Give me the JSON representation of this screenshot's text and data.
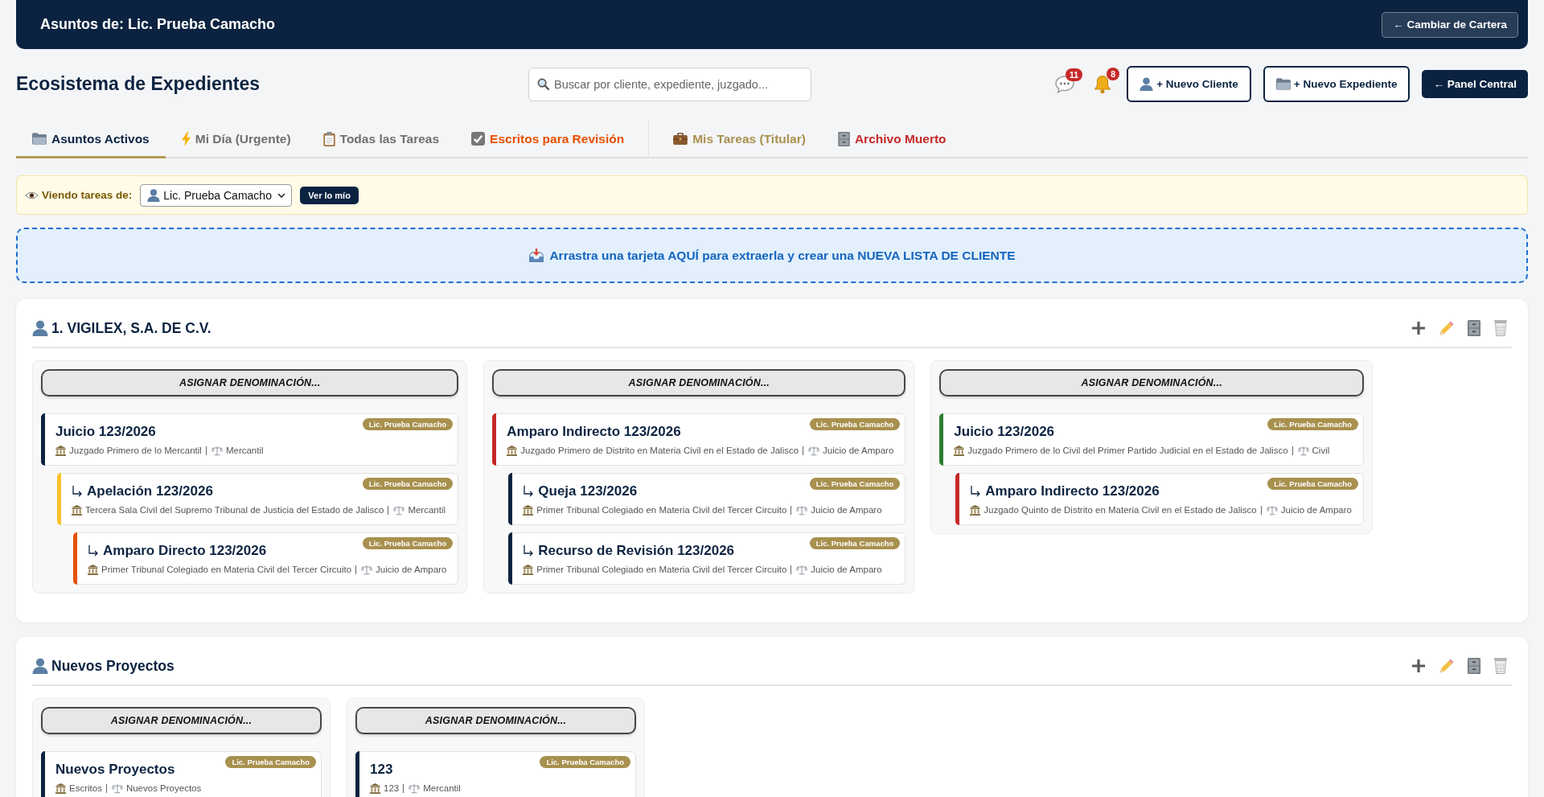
{
  "header": {
    "title": "Asuntos de: Lic. Prueba Camacho",
    "switch_button": "← Cambiar de Cartera"
  },
  "toolbar": {
    "title": "Ecosistema de Expedientes",
    "search": {
      "placeholder": "Buscar por cliente, expediente, juzgado..."
    },
    "messages_count": "11",
    "notifications_count": "8",
    "buttons": [
      {
        "label": "+ Nuevo Cliente",
        "kind": "client"
      },
      {
        "label": "+ Nuevo Expediente",
        "kind": "case"
      },
      {
        "label": "← Panel Central",
        "kind": "nav"
      }
    ]
  },
  "tabs": [
    {
      "label": "Asuntos Activos",
      "selected": true,
      "color": "#0b2340"
    },
    {
      "label": "Mi Día (Urgente)",
      "selected": false,
      "color": "#707070"
    },
    {
      "label": "Todas las Tareas",
      "selected": false,
      "color": "#707070"
    },
    {
      "label": "Escritos para Revisión",
      "selected": false,
      "color": "#e65100"
    },
    {
      "label": "Mis Tareas (Titular)",
      "selected": false,
      "color": "#a8904e"
    },
    {
      "label": "Archivo Muerto",
      "selected": false,
      "color": "#c62828"
    }
  ],
  "viewer_filter": {
    "label": "Viendo tareas de:",
    "value": "Lic. Prueba Camacho",
    "button": "Ver lo mío"
  },
  "drop_zone": {
    "text": "Arrastra una tarjeta AQUÍ para extraerla y crear una NUEVA LISTA DE CLIENTE"
  },
  "client_lists": [
    {
      "name": "1. VIGILEX, S.A. DE C.V.",
      "columns": [
        {
          "heading_button": "ASIGNAR DENOMINACIÓN...",
          "cases": [
            {
              "title": "Juicio 123/2026",
              "court": "Juzgado Primero de lo Mercantil",
              "matter": "Mercantil",
              "assignee": "Lic. Prueba Camacho",
              "color": "#0b2340",
              "children": [
                {
                  "title": "Apelación 123/2026",
                  "court": "Tercera Sala Civil del Supremo Tribunal de Justicia del Estado de Jalisco",
                  "matter": "Mercantil",
                  "assignee": "Lic. Prueba Camacho",
                  "color": "#fbc02d",
                  "children": [
                    {
                      "title": "Amparo Directo 123/2026",
                      "court": "Primer Tribunal Colegiado en Materia Civil del Tercer Circuito",
                      "matter": "Juicio de Amparo",
                      "assignee": "Lic. Prueba Camacho",
                      "color": "#e65100"
                    }
                  ]
                }
              ]
            }
          ]
        },
        {
          "heading_button": "ASIGNAR DENOMINACIÓN...",
          "cases": [
            {
              "title": "Amparo Indirecto 123/2026",
              "court": "Juzgado Primero de Distrito en Materia Civil en el Estado de Jalisco",
              "matter": "Juicio de Amparo",
              "assignee": "Lic. Prueba Camacho",
              "color": "#c62828",
              "children": [
                {
                  "title": "Queja 123/2026",
                  "court": "Primer Tribunal Colegiado en Materia Civil del Tercer Circuito",
                  "matter": "Juicio de Amparo",
                  "assignee": "Lic. Prueba Camacho",
                  "color": "#0b2340"
                },
                {
                  "title": "Recurso de Revisión 123/2026",
                  "court": "Primer Tribunal Colegiado en Materia Civil del Tercer Circuito",
                  "matter": "Juicio de Amparo",
                  "assignee": "Lic. Prueba Camacho",
                  "color": "#0b2340"
                }
              ]
            }
          ]
        },
        {
          "heading_button": "ASIGNAR DENOMINACIÓN...",
          "cases": [
            {
              "title": "Juicio 123/2026",
              "court": "Juzgado Primero de lo Civil del Primer Partido Judicial en el Estado de Jalisco",
              "matter": "Civil",
              "assignee": "Lic. Prueba Camacho",
              "color": "#2e7d32",
              "children": [
                {
                  "title": "Amparo Indirecto 123/2026",
                  "court": "Juzgado Quinto de Distrito en Materia Civil en el Estado de Jalisco",
                  "matter": "Juicio de Amparo",
                  "assignee": "Lic. Prueba Camacho",
                  "color": "#c62828"
                }
              ]
            }
          ]
        }
      ]
    },
    {
      "name": "Nuevos Proyectos",
      "columns": [
        {
          "heading_button": "ASIGNAR DENOMINACIÓN...",
          "cases": [
            {
              "title": "Nuevos Proyectos",
              "court": "Escritos",
              "matter": "Nuevos Proyectos",
              "assignee": "Lic. Prueba Camacho",
              "color": "#0b2340"
            }
          ]
        },
        {
          "heading_button": "ASIGNAR DENOMINACIÓN...",
          "cases": [
            {
              "title": "123",
              "court": "123",
              "matter": "Mercantil",
              "assignee": "Lic. Prueba Camacho",
              "color": "#0b2340"
            }
          ]
        }
      ]
    }
  ]
}
